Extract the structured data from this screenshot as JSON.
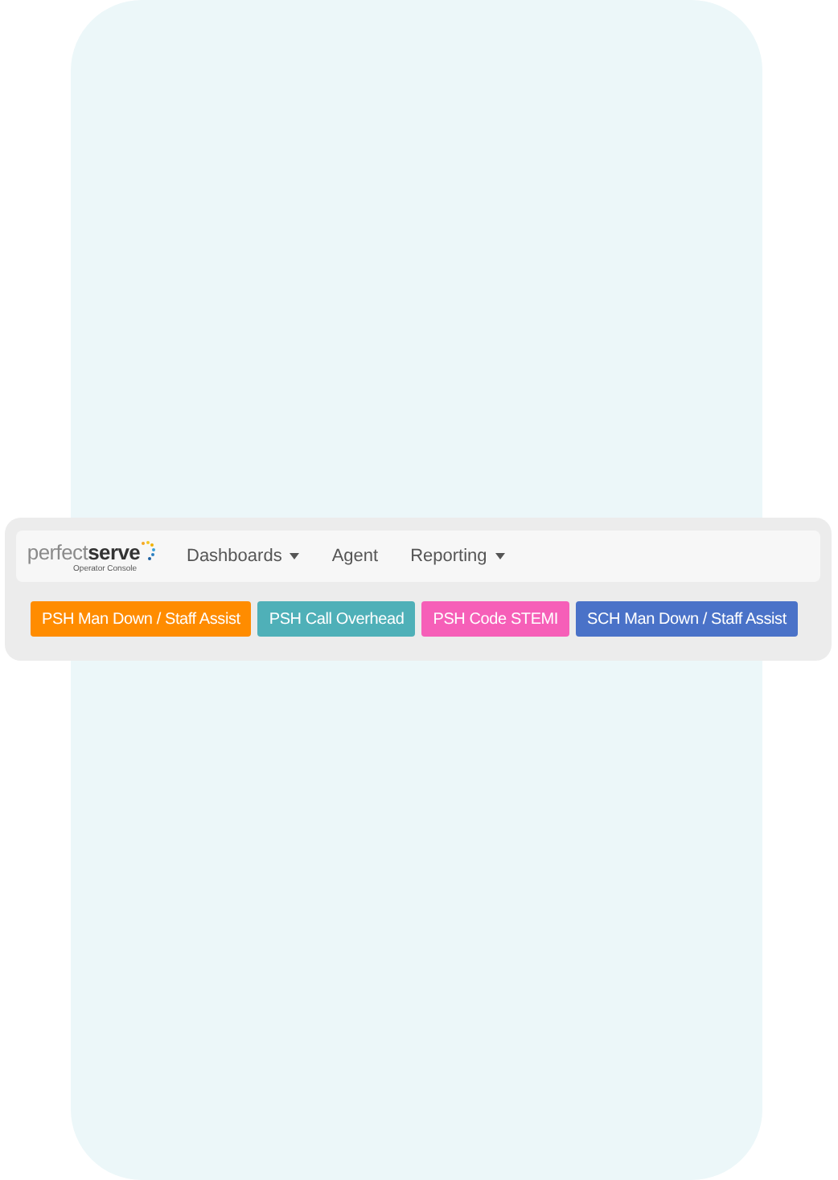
{
  "logo": {
    "wordmark": "perfect**serve**",
    "subtitle": "Operator Console"
  },
  "nav": [
    {
      "label": "Dashboards",
      "dropdown": true
    },
    {
      "label": "Agent",
      "dropdown": false
    },
    {
      "label": "Reporting",
      "dropdown": true
    }
  ],
  "alert_buttons": [
    {
      "label": "PSH Man Down / Staff Assist",
      "color": "#ff8c00"
    },
    {
      "label": "PSH Call Overhead",
      "color": "#4fb0b8"
    },
    {
      "label": "PSH Code STEMI",
      "color": "#f65fb8"
    },
    {
      "label": "SCH Man Down / Staff Assist",
      "color": "#4a72c8"
    }
  ]
}
